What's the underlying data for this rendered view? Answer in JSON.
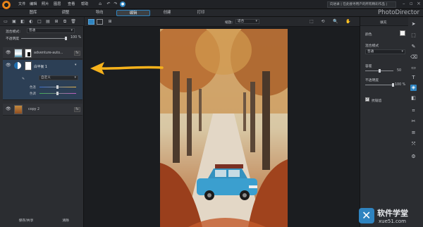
{
  "menu": [
    "文件",
    "编辑",
    "照片",
    "图层",
    "查看",
    "帮助"
  ],
  "signin": "向进录 | 在此搜寻用户的所有精彩作品 |",
  "nav_tabs": [
    {
      "label": "图库",
      "active": false
    },
    {
      "label": "调整",
      "active": false
    },
    {
      "label": "导向",
      "active": false
    },
    {
      "label": "编辑",
      "active": true
    },
    {
      "label": "创建",
      "active": false
    },
    {
      "label": "打印",
      "active": false
    }
  ],
  "brand": "PhotoDirector",
  "left": {
    "blend_label": "混合模式:",
    "blend_value": "普通",
    "opacity_label": "不透明度",
    "opacity_value": "100 %",
    "layers": [
      {
        "name": "adventure-auto...",
        "fx": "fx"
      },
      {
        "name": "白平衡 1",
        "fx": "fx"
      },
      {
        "name": "copy 2",
        "fx": "fx"
      }
    ],
    "sub_dropdown": "自定义",
    "slider1_label": "色温",
    "slider2_label": "色调",
    "save_button": "保存/共享",
    "clear_button": "清除"
  },
  "center": {
    "zoom_label": "缩放:",
    "zoom_value": "适合"
  },
  "right": {
    "title": "填充",
    "color_label": "颜色",
    "blend_label": "混合模式",
    "blend_value": "普通",
    "threshold_label": "容差",
    "threshold_value": "50",
    "opacity_label": "不透明度",
    "opacity_value": "100 %",
    "checkbox_label": "抗锯齿",
    "threshold_fraction": 0.5,
    "opacity_fraction": 1.0
  },
  "watermark": {
    "title": "软件学堂",
    "url": "xue51.com"
  },
  "colors": {
    "accent": "#2f84c0",
    "arrow": "#f6b21b",
    "panel": "#2b2d31"
  }
}
